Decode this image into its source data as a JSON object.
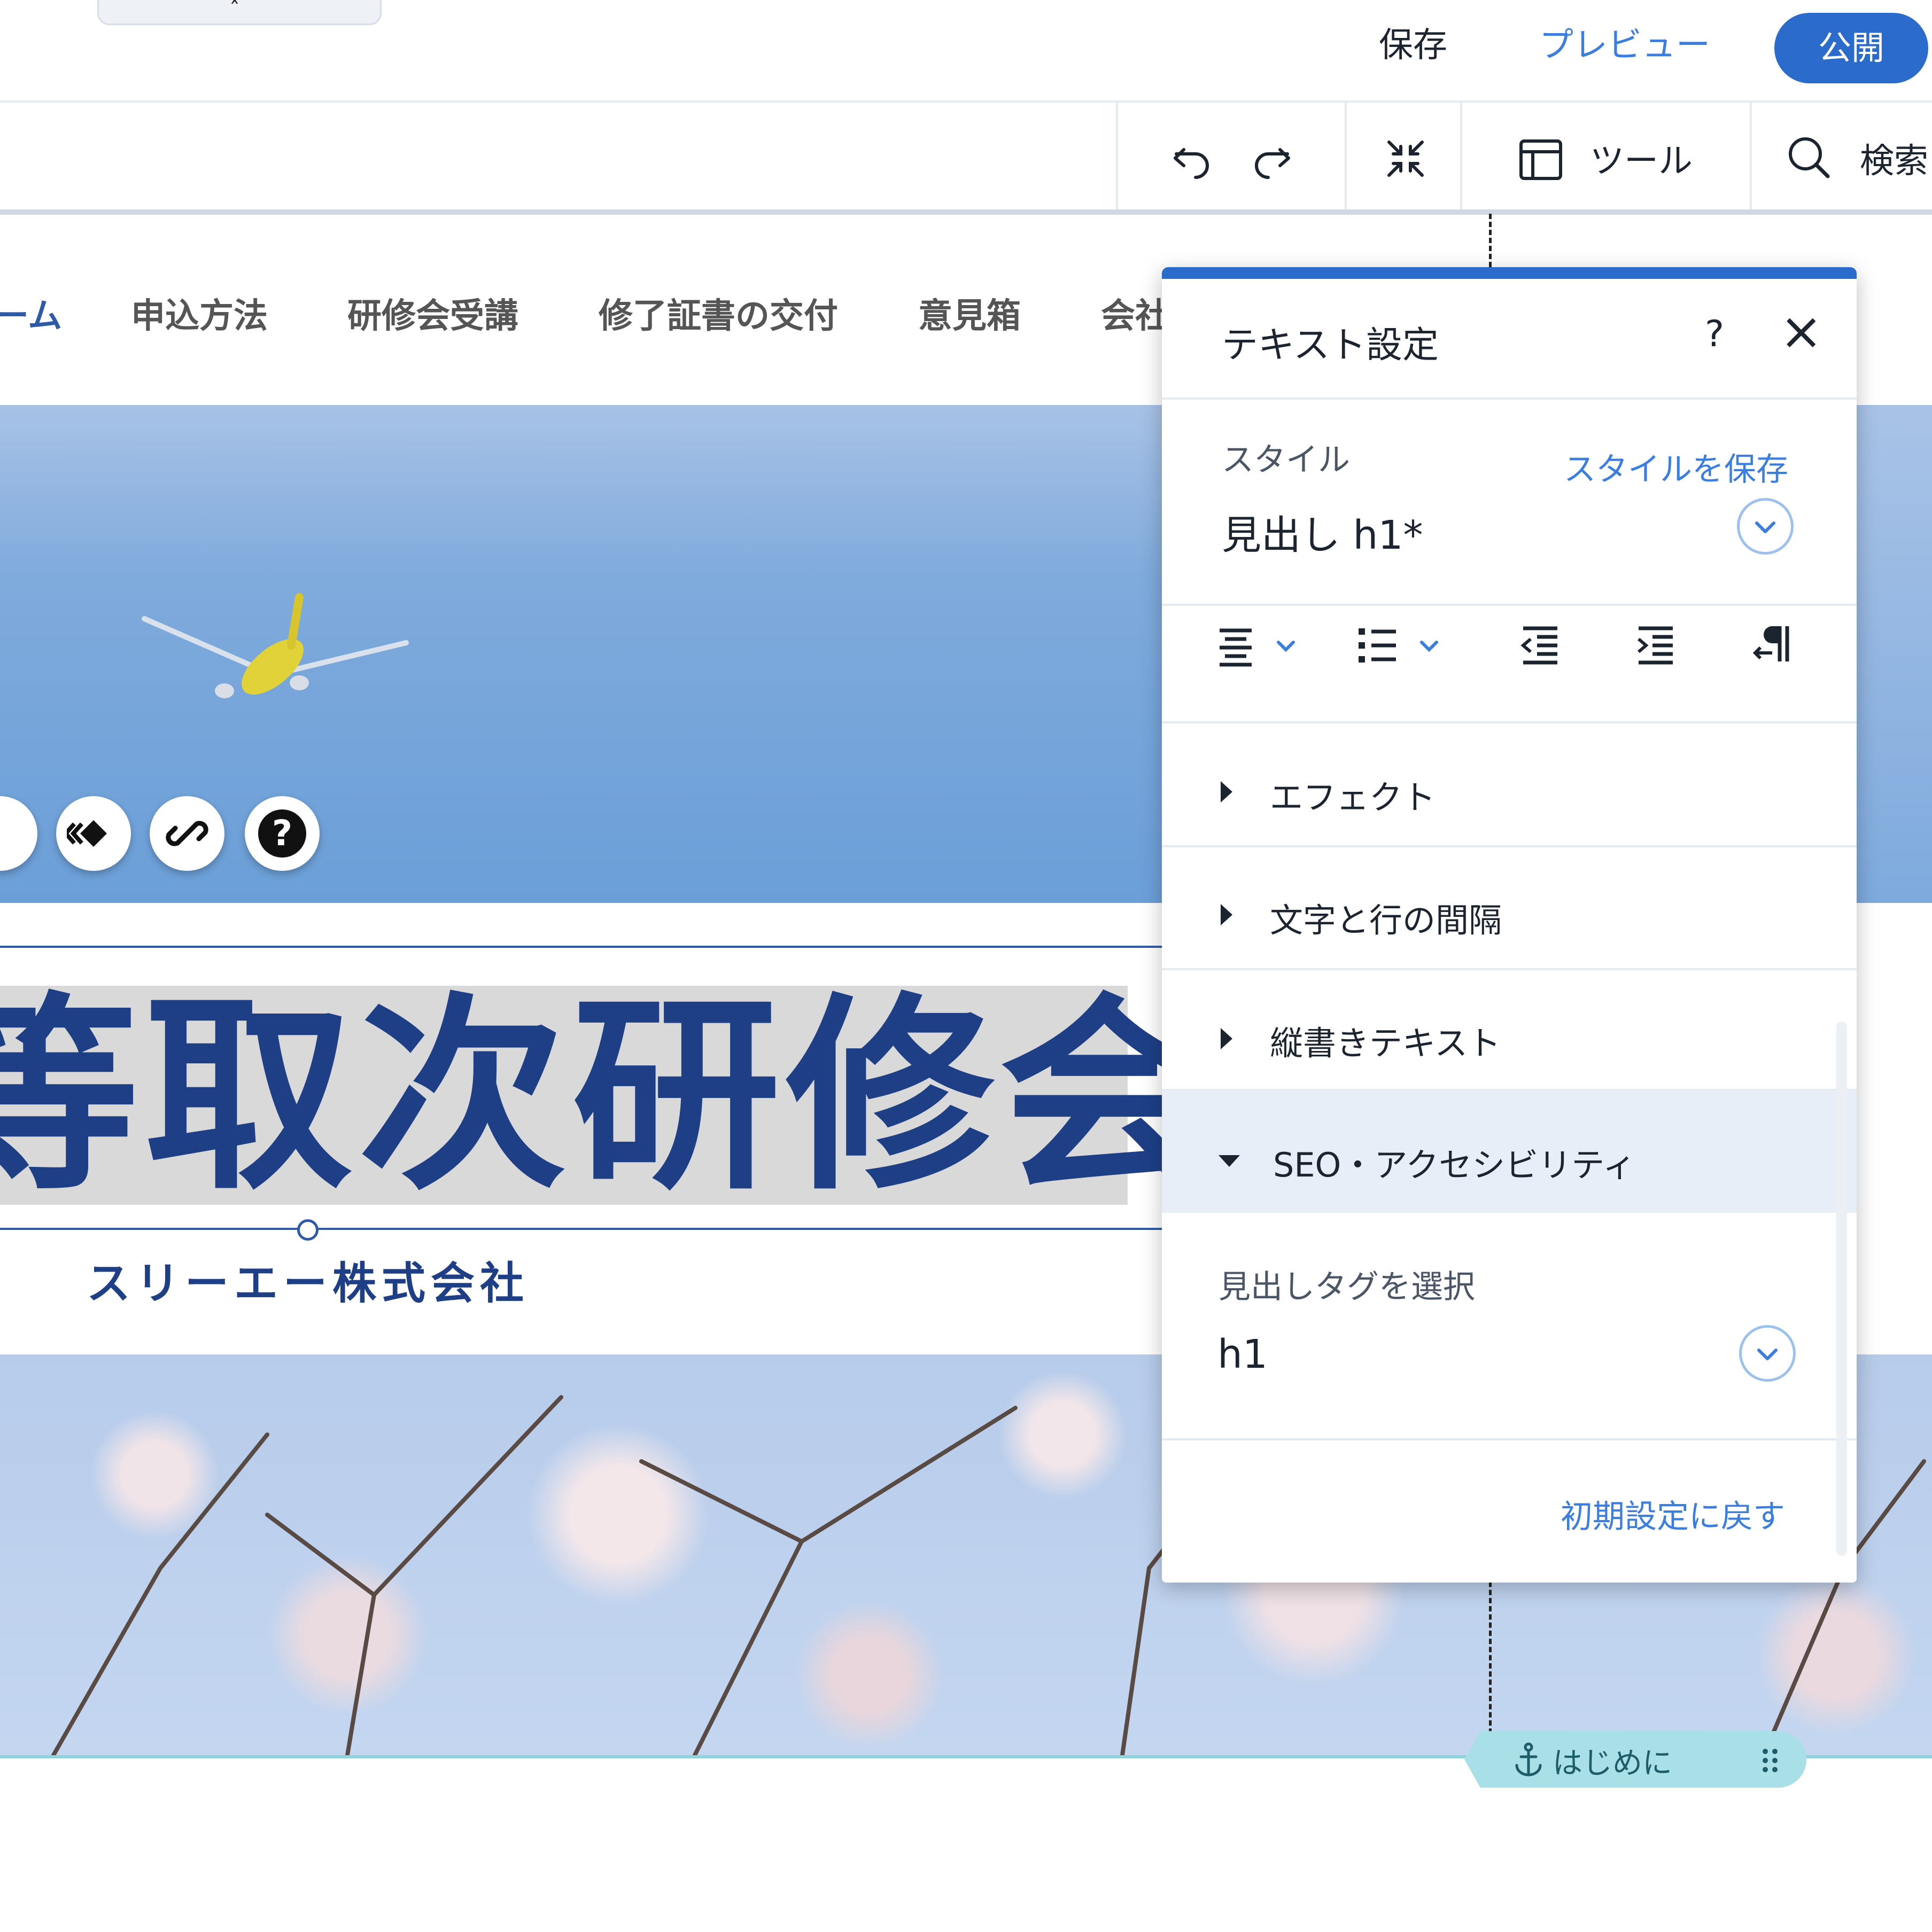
{
  "topbar": {
    "save_label": "保存",
    "preview_label": "プレビュー",
    "publish_label": "公開",
    "pull_tab_icon": "chevron-up-icon"
  },
  "toolbar": {
    "undo_icon": "undo-icon",
    "redo_icon": "redo-icon",
    "collapse_icon": "collapse-icon",
    "tools_icon": "layout-panel-icon",
    "tools_label": "ツール",
    "search_icon": "search-icon",
    "search_label": "検索"
  },
  "site": {
    "nav": [
      "ーム",
      "申込方法",
      "研修会受講",
      "修了証書の交付",
      "意見箱",
      "会社"
    ],
    "nav_active_index": 0,
    "title": "等取次研修会",
    "subtitle": "スリーエー株式会社",
    "section_tag": "はじめに",
    "floating_tools": [
      "animation-icon",
      "link-icon",
      "help-icon"
    ],
    "help_glyph": "?"
  },
  "panel": {
    "title": "テキスト設定",
    "help_icon": "?",
    "close_icon": "×",
    "style_label": "スタイル",
    "save_style_link": "スタイルを保存",
    "style_value": "見出し h1*",
    "format_icons": [
      "align-icon",
      "list-icon",
      "outdent-icon",
      "indent-icon",
      "rtl-paragraph-icon"
    ],
    "sections": [
      {
        "label": "エフェクト",
        "expanded": false
      },
      {
        "label": "文字と行の間隔",
        "expanded": false
      },
      {
        "label": "縦書きテキスト",
        "expanded": false
      },
      {
        "label": "SEO・アクセシビリティ",
        "expanded": true
      }
    ],
    "heading_tag_label": "見出しタグを選択",
    "heading_tag_value": "h1",
    "reset_link": "初期設定に戻す"
  },
  "colors": {
    "accent": "#2a6bcc",
    "link": "#3b7ee0",
    "title_navy": "#1e3f86",
    "panel_highlight": "#e7eef8",
    "section_tag": "#a9dfe6"
  }
}
